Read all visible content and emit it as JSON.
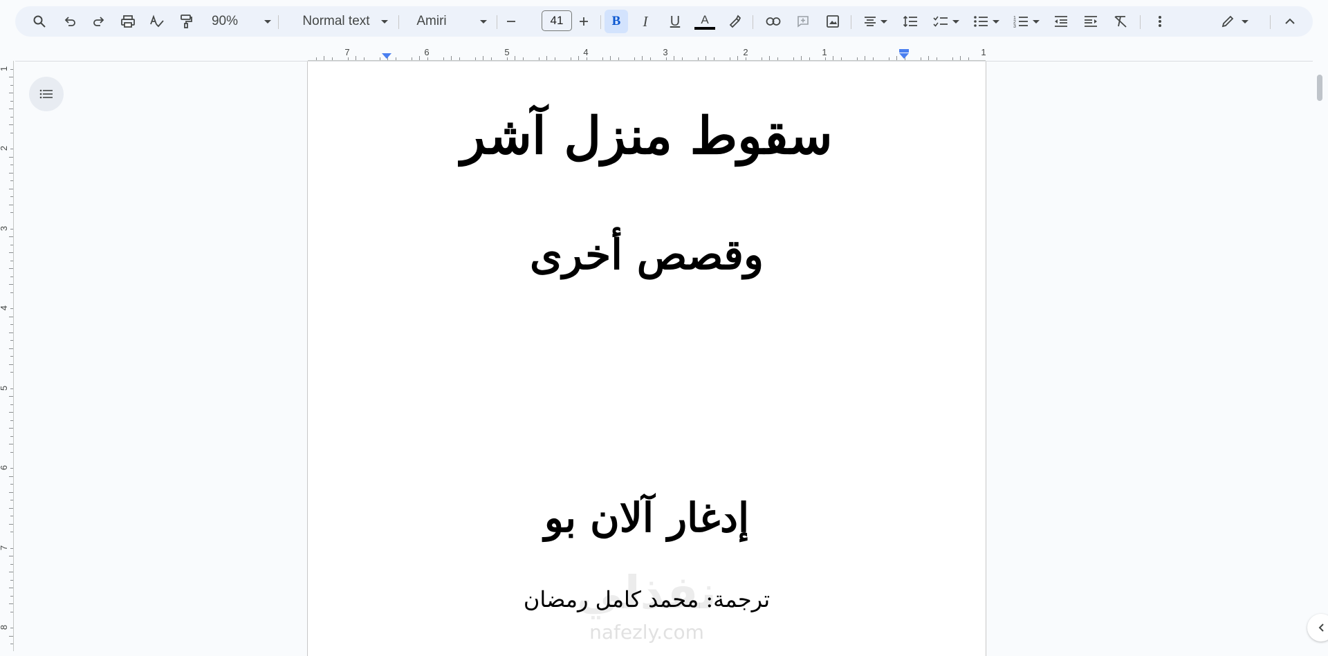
{
  "toolbar": {
    "zoom": "90%",
    "style": "Normal text",
    "font": "Amiri",
    "font_size": "41",
    "bold_label": "B",
    "italic_label": "I",
    "underline_label": "U",
    "text_color_label": "A",
    "text_color": "#000000",
    "active_color": "#d3e3fd",
    "icons": [
      "search-icon",
      "undo-icon",
      "redo-icon",
      "print-icon",
      "spellcheck-icon",
      "paint-format-icon",
      "decrease-font-icon",
      "increase-font-icon",
      "highlight-icon",
      "link-icon",
      "add-comment-icon",
      "insert-image-icon",
      "align-center-icon",
      "line-spacing-icon",
      "checklist-icon",
      "bulleted-list-icon",
      "numbered-list-icon",
      "decrease-indent-icon",
      "increase-indent-icon",
      "clear-formatting-icon",
      "more-icon",
      "edit-mode-icon",
      "collapse-menu-icon"
    ]
  },
  "ruler": {
    "horizontal": [
      "7",
      "6",
      "5",
      "4",
      "3",
      "2",
      "1",
      "1"
    ],
    "vertical": [
      "1",
      "2",
      "3",
      "4",
      "5",
      "6",
      "7",
      "8"
    ]
  },
  "document": {
    "title": "سقوط منزل آشر",
    "subtitle": "وقصص أخرى",
    "author": "إدغار آلان بو",
    "translator": "ترجمة: محمد كامل رمضان",
    "watermark": "نفذلي",
    "watermark_url": "nafezly.com"
  }
}
